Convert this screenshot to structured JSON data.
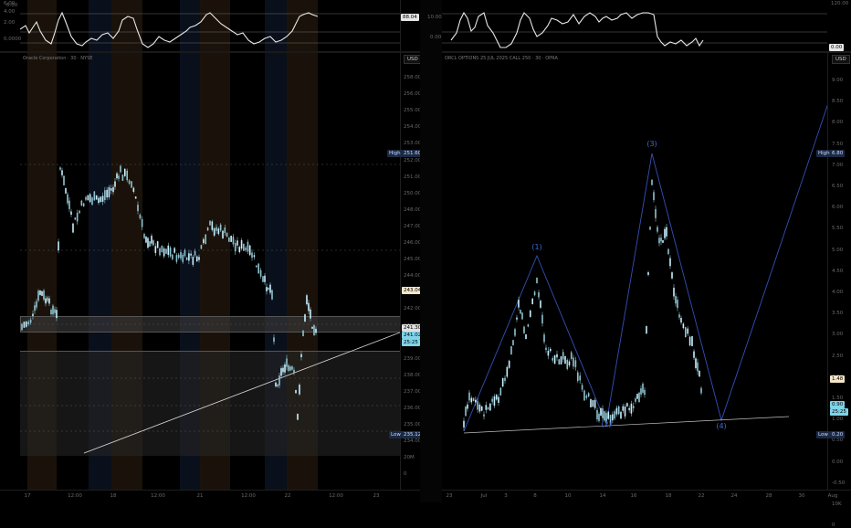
{
  "left_chart": {
    "title": "Oracle Corporation · 30 · NYSE",
    "currency": "USD",
    "osc_scale": [
      "6.00",
      "4.00",
      "2.00",
      "0.0000"
    ],
    "osc_value": "88.04",
    "price_scale": [
      "258.00",
      "256.00",
      "255.00",
      "254.00",
      "253.00",
      "252.00",
      "251.00",
      "250.00",
      "248.00",
      "247.00",
      "246.00",
      "245.00",
      "244.00",
      "243.00",
      "242.00",
      "241.00",
      "240.00",
      "239.00",
      "238.00",
      "237.00",
      "236.00",
      "235.00",
      "234.00",
      "20M",
      "0"
    ],
    "high_label": "High",
    "high_value": "251.60",
    "low_label": "Low",
    "low_value": "235.12",
    "price_a": "243.04",
    "price_b": "241.30",
    "price_c": "241.02",
    "countdown": "25:25",
    "x_labels": [
      "17",
      "12:00",
      "18",
      "12:00",
      "21",
      "12:00",
      "22",
      "12:00",
      "23"
    ]
  },
  "right_chart": {
    "title": "ORCL OPTIONS 25 JUL 2025 CALL 250 · 30 · OPRA",
    "currency": "USD",
    "osc_scale": [
      "120.00",
      "10.00",
      "0.00",
      "0.00"
    ],
    "osc_value": "0.00",
    "price_scale": [
      "9.00",
      "8.50",
      "8.00",
      "7.50",
      "7.00",
      "6.50",
      "6.00",
      "5.50",
      "5.00",
      "4.50",
      "4.00",
      "3.50",
      "3.00",
      "2.50",
      "2.00",
      "1.50",
      "1.00",
      "0.50",
      "0.00",
      "-0.50",
      "10K",
      "0"
    ],
    "high_label": "High",
    "high_value": "6.80",
    "low_label": "Low",
    "low_value": "0.20",
    "price_a": "1.48",
    "price_b": "0.90",
    "countdown": "25:25",
    "wave_labels": [
      "(1)",
      "(2)",
      "(3)",
      "(4)"
    ],
    "x_labels": [
      "23",
      "Jul",
      "3",
      "8",
      "10",
      "14",
      "16",
      "18",
      "22",
      "24",
      "28",
      "30",
      "Aug"
    ]
  },
  "colors": {
    "candle": "#8fc3cf",
    "candle_bright": "#c8f0ff",
    "wave_line": "#3550b8",
    "trend_line": "#dcdcdc",
    "band_orange": "#1a120a",
    "band_blue": "#0a0f1c"
  }
}
